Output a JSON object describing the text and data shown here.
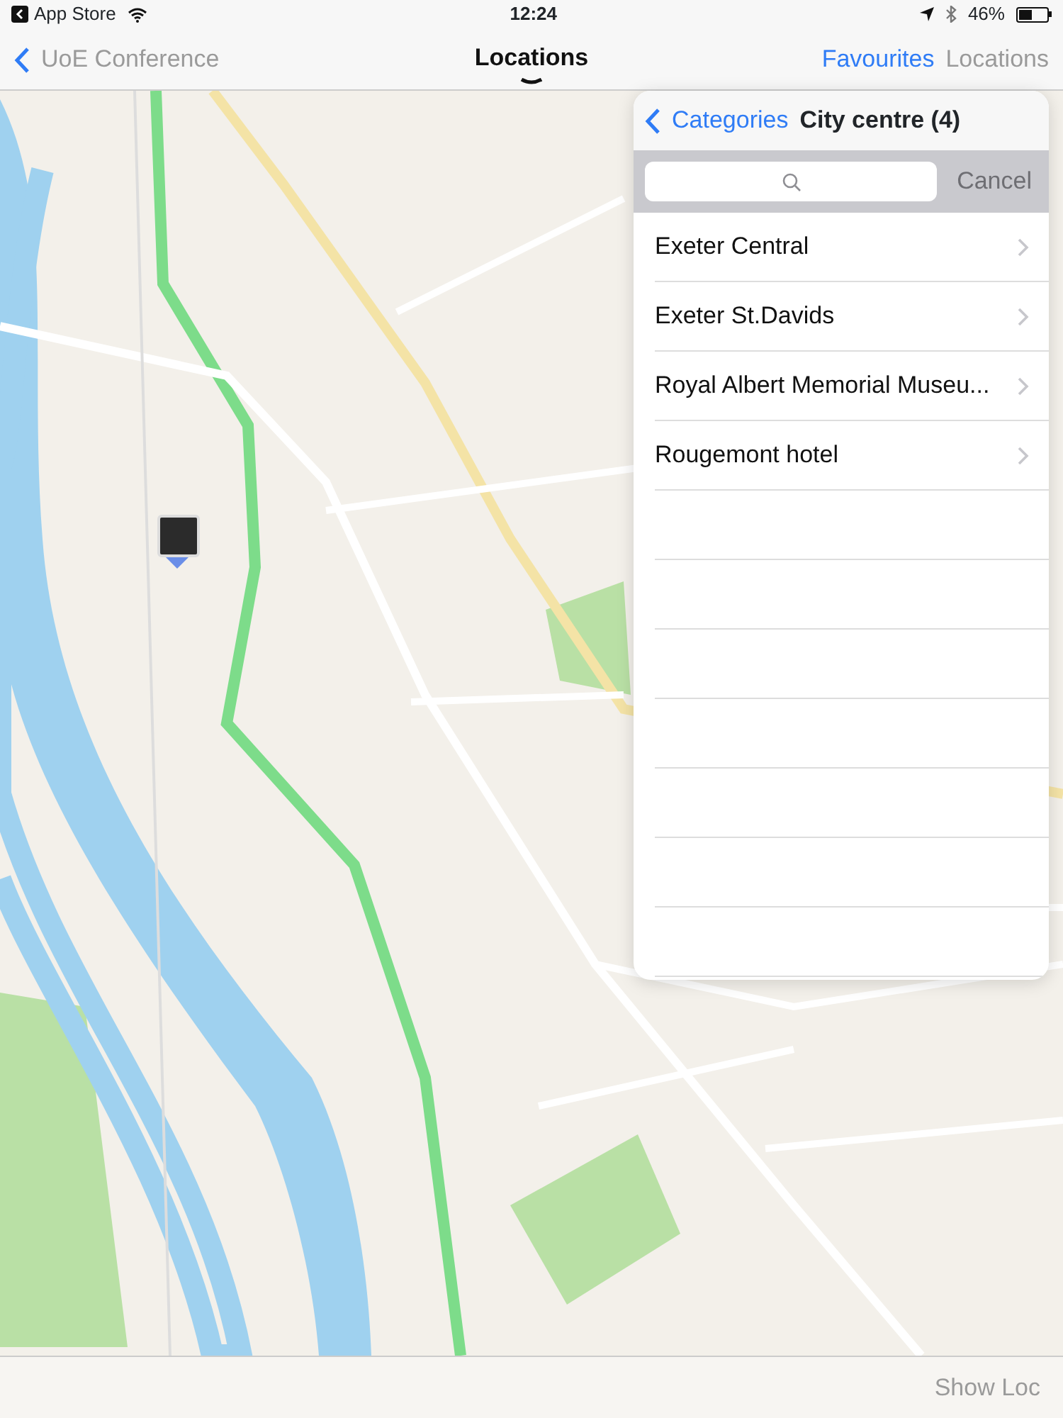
{
  "status_bar": {
    "back_app": "App Store",
    "time": "12:24",
    "battery_text": "46%",
    "battery": {
      "level": 0.46
    }
  },
  "nav_bar": {
    "back": "UoE Conference",
    "title": "Locations",
    "buttons": [
      {
        "label": "Favourites",
        "selected": false
      },
      {
        "label": "Locations",
        "selected": true
      }
    ]
  },
  "popover": {
    "back": "Categories",
    "title": "City centre (4)",
    "search": {
      "cancel": "Cancel",
      "cancel_disabled": true
    },
    "items": [
      {
        "label": "Exeter Central"
      },
      {
        "label": "Exeter St.Davids"
      },
      {
        "label": "Royal Albert Memorial Museu..."
      },
      {
        "label": "Rougemont hotel"
      }
    ]
  },
  "toolbar": {
    "button": "Show Loc",
    "disabled": true
  }
}
